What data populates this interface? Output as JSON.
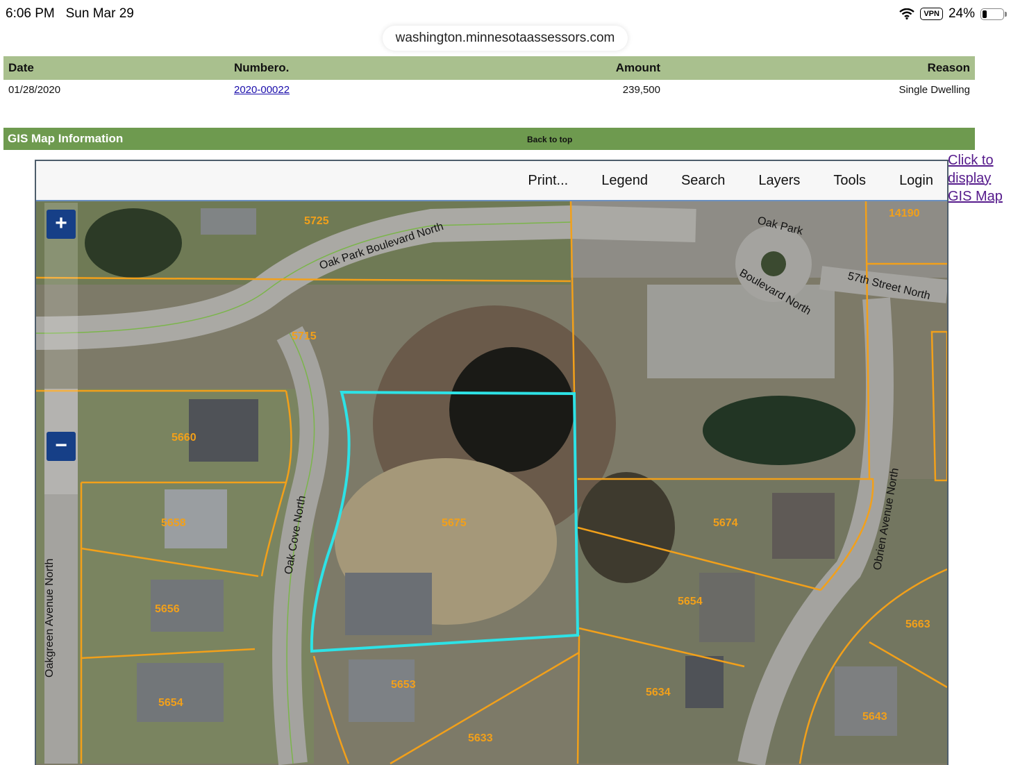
{
  "status_bar": {
    "time": "6:06 PM",
    "date": "Sun Mar 29",
    "vpn": "VPN",
    "battery": "24%"
  },
  "browser": {
    "url": "washington.minnesotaassessors.com"
  },
  "permits": {
    "headers": [
      "Date",
      "Numbero.",
      "Amount",
      "Reason"
    ],
    "rows": [
      {
        "date": "01/28/2020",
        "number": "2020-00022",
        "amount": "239,500",
        "reason": "Single Dwelling"
      }
    ]
  },
  "gis": {
    "title": "GIS Map Information",
    "back_to_top": "Back to top",
    "side_link": "Click to display GIS Map",
    "toolbar": [
      "Print...",
      "Legend",
      "Search",
      "Layers",
      "Tools",
      "Login"
    ],
    "zoom_in": "+",
    "zoom_out": "−",
    "parcel_labels": [
      "5725",
      "5715",
      "14190",
      "5660",
      "5658",
      "5675",
      "5674",
      "5656",
      "5654",
      "5653",
      "5634",
      "5633",
      "5663",
      "5643"
    ],
    "street_labels": [
      "Oak Park Boulevard North",
      "Oak Park",
      "Boulevard North",
      "57th Street North",
      "Oak Cove North",
      "Obrien Avenue North",
      "Oakgreen Avenue North"
    ],
    "highlight_color": "#2de2e6",
    "parcel_line_color": "#f2a01a"
  }
}
